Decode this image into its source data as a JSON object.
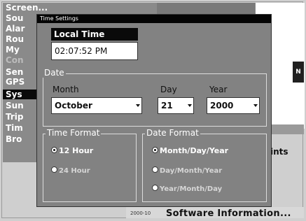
{
  "background_menu": {
    "items": [
      {
        "label": "Screen...",
        "dim": false,
        "selected": false
      },
      {
        "label": "Sou",
        "dim": false,
        "selected": false
      },
      {
        "label": "Alar",
        "dim": false,
        "selected": false
      },
      {
        "label": "Rou",
        "dim": false,
        "selected": false
      },
      {
        "label": "My",
        "dim": false,
        "selected": false
      },
      {
        "label": "Con",
        "dim": true,
        "selected": false
      },
      {
        "label": "Sen",
        "dim": false,
        "selected": false
      },
      {
        "label": "GPS",
        "dim": false,
        "selected": false
      },
      {
        "label": "Sys",
        "dim": false,
        "selected": true
      },
      {
        "label": "Sun",
        "dim": false,
        "selected": false
      },
      {
        "label": "Trip",
        "dim": false,
        "selected": false
      },
      {
        "label": "Tim",
        "dim": false,
        "selected": false
      },
      {
        "label": "Bro",
        "dim": false,
        "selected": false
      }
    ],
    "right_text": "ints",
    "bottom_small": "2000-10",
    "bottom_text": "Software Information..."
  },
  "dialog": {
    "title": "Time Settings",
    "local_time_label": "Local Time",
    "local_time_value": "02:07:52 PM",
    "date": {
      "group_label": "Date",
      "month_label": "Month",
      "month_value": "October",
      "day_label": "Day",
      "day_value": "21",
      "year_label": "Year",
      "year_value": "2000"
    },
    "time_format": {
      "group_label": "Time Format",
      "options": [
        {
          "label": "12 Hour",
          "checked": true
        },
        {
          "label": "24 Hour",
          "checked": false
        }
      ]
    },
    "date_format": {
      "group_label": "Date Format",
      "options": [
        {
          "label": "Month/Day/Year",
          "checked": true
        },
        {
          "label": "Day/Month/Year",
          "checked": false
        },
        {
          "label": "Year/Month/Day",
          "checked": false
        }
      ]
    }
  }
}
